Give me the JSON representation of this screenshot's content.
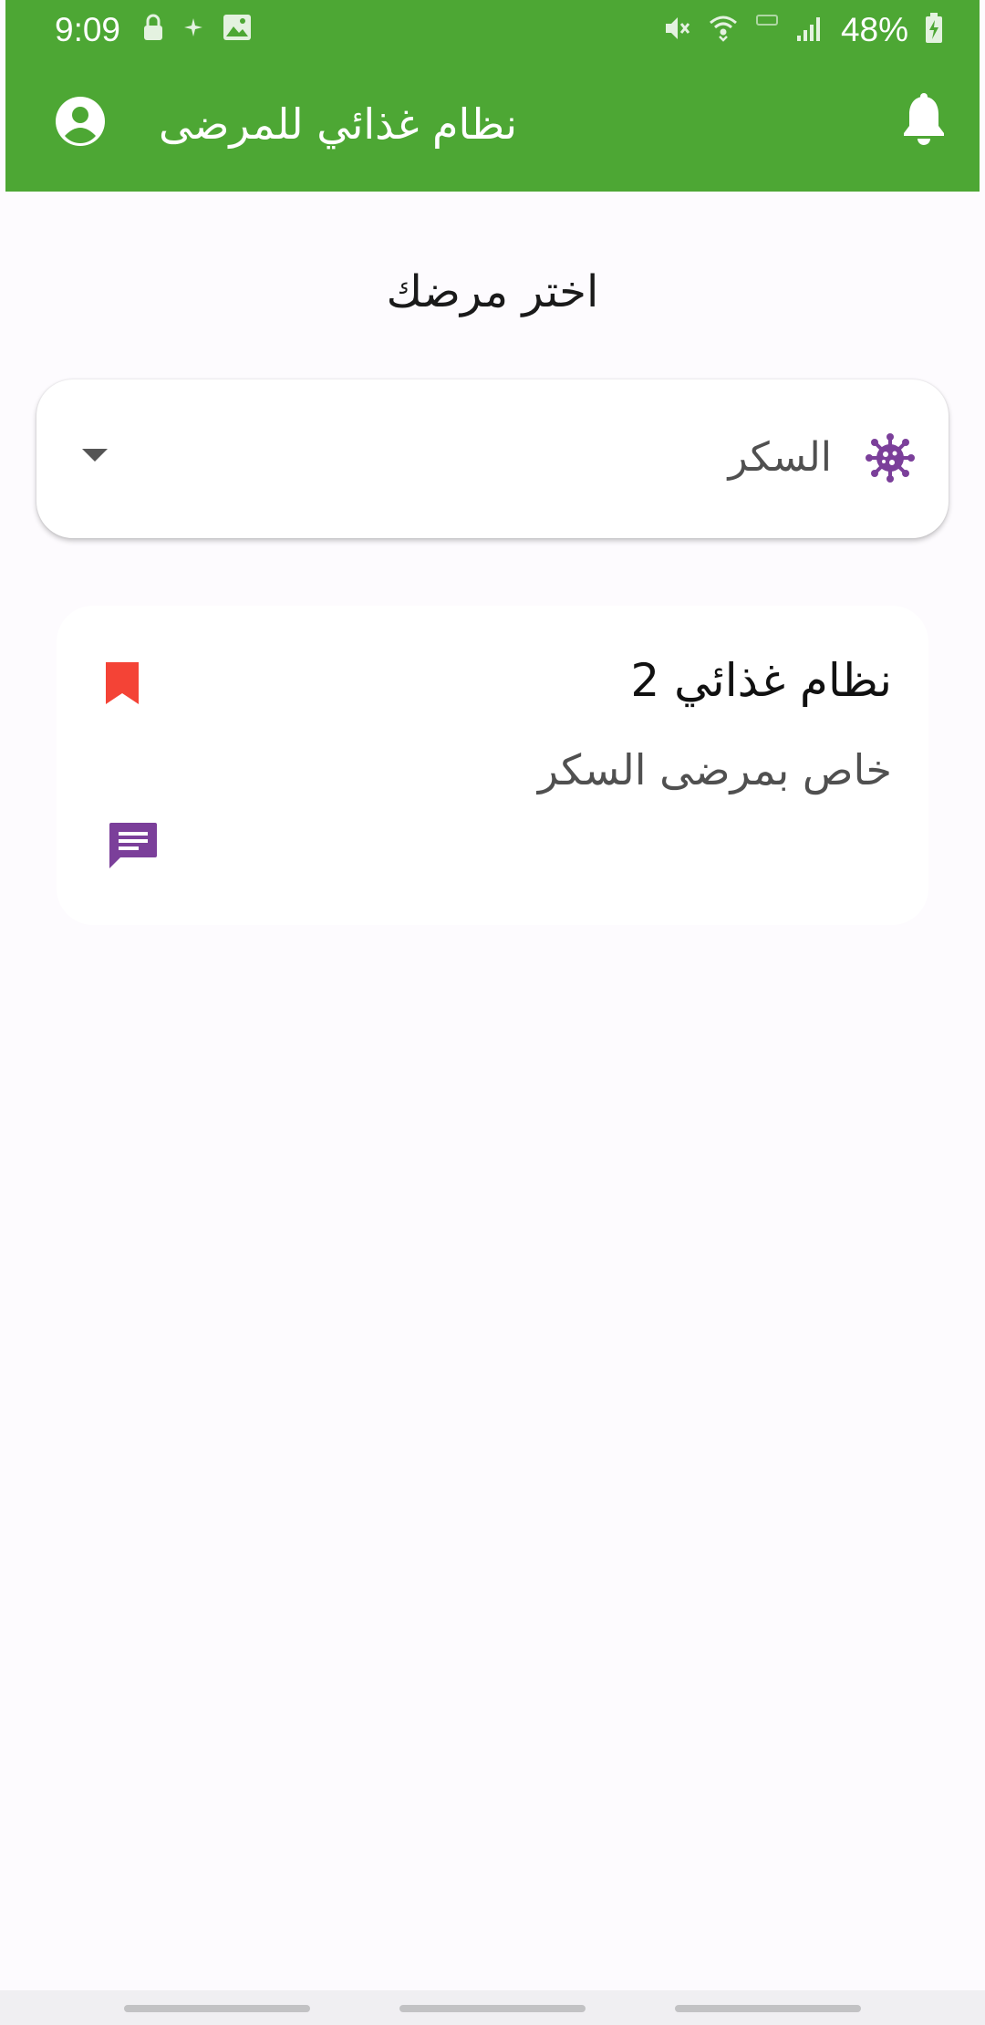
{
  "status_bar": {
    "time": "9:09",
    "battery": "48%",
    "icons": [
      "lock-icon",
      "sparkle-icon",
      "image-icon",
      "mute-icon",
      "wifi-icon",
      "volte-icon",
      "signal-icon",
      "battery-icon"
    ]
  },
  "app_bar": {
    "title": "نظام غذائي للمرضى",
    "icons": [
      "account-circle-icon",
      "bell-icon"
    ],
    "color": "#4da734"
  },
  "main": {
    "section_title": "اختر مرضك",
    "dropdown": {
      "selected_value": "السكر",
      "icon": "virus-icon",
      "icon_color": "#7b3f9a"
    },
    "cards": [
      {
        "title": "نظام غذائي 2",
        "subtitle": "خاص بمرضى السكر",
        "bookmark_color": "#f44336",
        "chat_color": "#7b3f9a"
      }
    ]
  }
}
